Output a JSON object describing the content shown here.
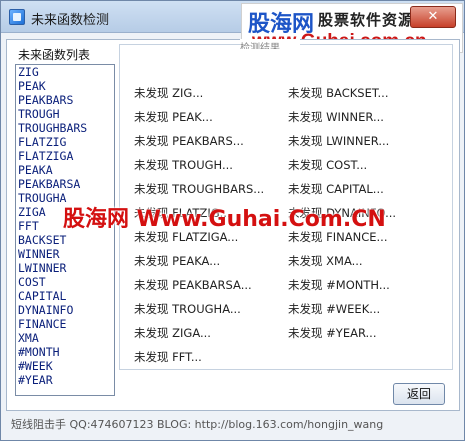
{
  "window": {
    "title": "未来函数检测",
    "close_label": "✕"
  },
  "brand": {
    "main": "股海网",
    "sub": "股票软件资源分享",
    "url": "www.Guhai.com.cn"
  },
  "list": {
    "title": "未来函数列表",
    "items": [
      "ZIG",
      "PEAK",
      "PEAKBARS",
      "TROUGH",
      "TROUGHBARS",
      "FLATZIG",
      "FLATZIGA",
      "PEAKA",
      "PEAKBARSA",
      "TROUGHA",
      "ZIGA",
      "FFT",
      "BACKSET",
      "WINNER",
      "LWINNER",
      "COST",
      "CAPITAL",
      "DYNAINFO",
      "FINANCE",
      "XMA",
      "#MONTH",
      "#WEEK",
      "#YEAR"
    ]
  },
  "results": {
    "legend": "检测结果",
    "left": [
      "未发现 ZIG...",
      "未发现 PEAK...",
      "未发现 PEAKBARS...",
      "未发现 TROUGH...",
      "未发现 TROUGHBARS...",
      "未发现 FLATZIG...",
      "未发现 FLATZIGA...",
      "未发现 PEAKA...",
      "未发现 PEAKBARSA...",
      "未发现 TROUGHA...",
      "未发现 ZIGA...",
      "未发现 FFT..."
    ],
    "right": [
      "未发现 BACKSET...",
      "未发现 WINNER...",
      "未发现 LWINNER...",
      "未发现 COST...",
      "未发现 CAPITAL...",
      "未发现 DYNAINFO...",
      "未发现 FINANCE...",
      "未发现 XMA...",
      "未发现 #MONTH...",
      "未发现 #WEEK...",
      "未发现 #YEAR..."
    ]
  },
  "watermark": "股海网 Www.Guhai.Com.CN",
  "buttons": {
    "return_label": "返回"
  },
  "status": {
    "text": "短线阻击手  QQ:474607123  BLOG: http://blog.163.com/hongjin_wang"
  }
}
